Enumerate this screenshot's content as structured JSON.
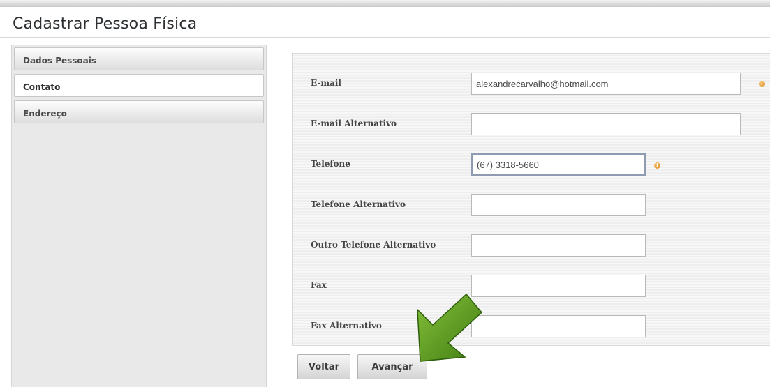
{
  "page": {
    "title": "Cadastrar Pessoa Física"
  },
  "sidebar": {
    "items": [
      {
        "label": "Dados Pessoais",
        "active": false
      },
      {
        "label": "Contato",
        "active": true
      },
      {
        "label": "Endereço",
        "active": false
      }
    ]
  },
  "form": {
    "required_icon": "!",
    "fields": [
      {
        "label": "E-mail",
        "value": "alexandrecarvalho@hotmail.com",
        "required": true
      },
      {
        "label": "E-mail Alternativo",
        "value": "",
        "required": false
      },
      {
        "label": "Telefone",
        "value": "(67) 3318-5660",
        "required": true,
        "focused": true
      },
      {
        "label": "Telefone Alternativo",
        "value": "",
        "required": false
      },
      {
        "label": "Outro Telefone Alternativo",
        "value": "",
        "required": false
      },
      {
        "label": "Fax",
        "value": "",
        "required": false
      },
      {
        "label": "Fax Alternativo",
        "value": "",
        "required": false
      }
    ]
  },
  "actions": {
    "back_label": "Voltar",
    "next_label": "Avançar"
  },
  "colors": {
    "pointer_arrow": "#5a9a1f",
    "required_icon": "#e39a2e"
  },
  "icons": {
    "pointer": "arrow-pointer-icon",
    "required": "warning-icon"
  }
}
